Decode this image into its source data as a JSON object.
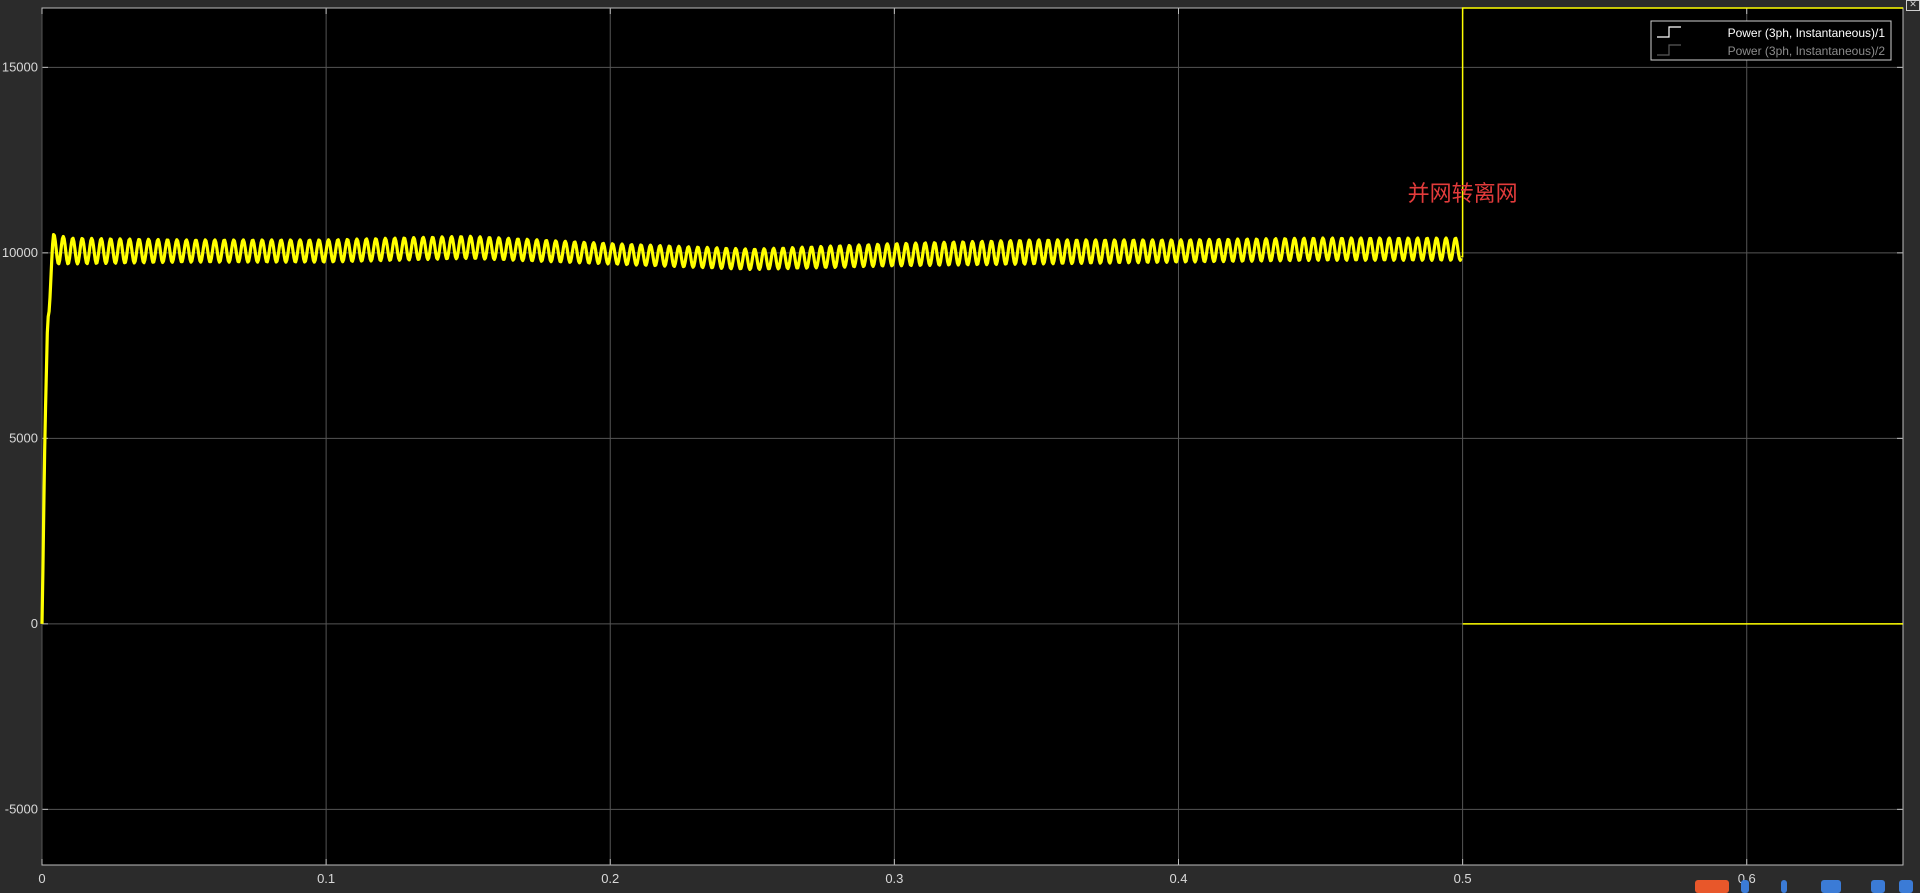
{
  "chart_data": {
    "type": "line",
    "title": "",
    "xlabel": "",
    "ylabel": "",
    "xlim": [
      0,
      0.655
    ],
    "ylim": [
      -6500,
      16600
    ],
    "xticks": [
      0,
      0.1,
      0.2,
      0.3,
      0.4,
      0.5,
      0.6
    ],
    "xtick_labels": [
      "0",
      "0.1",
      "0.2",
      "0.3",
      "0.4",
      "0.5",
      "0.6"
    ],
    "yticks": [
      -5000,
      0,
      5000,
      10000,
      15000
    ],
    "ytick_labels": [
      "-5000",
      "0",
      "5000",
      "10000",
      "15000"
    ],
    "grid": true,
    "legend_position": "top-right",
    "background": "#000000",
    "series": [
      {
        "name": "Power (3ph, Instantaneous)/1",
        "color": "#ffff00",
        "envelope_x": [
          0,
          0.001,
          0.002,
          0.004,
          0.01,
          0.05,
          0.1,
          0.15,
          0.2,
          0.25,
          0.3,
          0.35,
          0.4,
          0.45,
          0.4995
        ],
        "envelope_upper": [
          0,
          5000,
          9500,
          10500,
          10400,
          10350,
          10350,
          10450,
          10250,
          10100,
          10250,
          10350,
          10350,
          10400,
          10400
        ],
        "envelope_lower": [
          0,
          3000,
          8000,
          9700,
          9700,
          9750,
          9750,
          9850,
          9700,
          9550,
          9650,
          9700,
          9750,
          9800,
          9800
        ],
        "x_step": [
          0.4995,
          0.5,
          0.5,
          0.655
        ],
        "y_step": [
          9900,
          9900,
          16600,
          16600
        ],
        "x_after": [
          0.5,
          0.655
        ],
        "y_after": [
          0,
          0
        ]
      },
      {
        "name": "Power (3ph, Instantaneous)/2",
        "color": "#4a4a4a",
        "x": [],
        "y": []
      }
    ],
    "annotations": [
      {
        "text": "并网转离网",
        "x": 0.5,
        "y": 11400,
        "color": "#e23b3b"
      }
    ]
  }
}
